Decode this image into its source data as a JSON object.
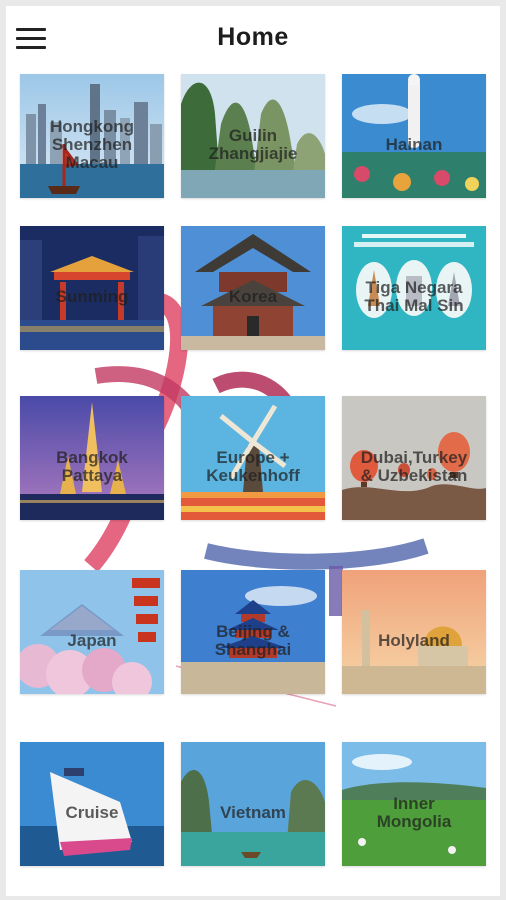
{
  "app_bar": {
    "title": "Home",
    "menu_icon": "hamburger-menu-icon"
  },
  "destinations": [
    {
      "label": "Hongkong\nShenzhen\nMacau",
      "icon": "city-skyline-icon"
    },
    {
      "label": "Guilin\nZhangjiajie",
      "icon": "karst-mountain-icon"
    },
    {
      "label": "Hainan",
      "icon": "statue-icon"
    },
    {
      "label": "Sunming",
      "icon": "gate-icon"
    },
    {
      "label": "Korea",
      "icon": "palace-icon"
    },
    {
      "label": "Tiga Negara\nThai Mal Sin",
      "icon": "poster-icon"
    },
    {
      "label": "Bangkok\nPattaya",
      "icon": "temple-icon"
    },
    {
      "label": "Europe +\nKeukenhoff",
      "icon": "windmill-icon"
    },
    {
      "label": "Dubai,Turkey\n& Uzbekistan",
      "icon": "hot-air-balloon-icon"
    },
    {
      "label": "Japan",
      "icon": "pagoda-icon"
    },
    {
      "label": "Beijing &\nShanghai",
      "icon": "temple-of-heaven-icon"
    },
    {
      "label": "Holyland",
      "icon": "dome-icon"
    },
    {
      "label": "Cruise",
      "icon": "cruise-ship-icon"
    },
    {
      "label": "Vietnam",
      "icon": "bay-icon"
    },
    {
      "label": "Inner\nMongolia",
      "icon": "grassland-icon"
    }
  ],
  "colors": {
    "background": "#ffffff",
    "title": "#1d1d1d",
    "deco_pink": "#e14b6b",
    "deco_blue": "#5b6fb0"
  }
}
